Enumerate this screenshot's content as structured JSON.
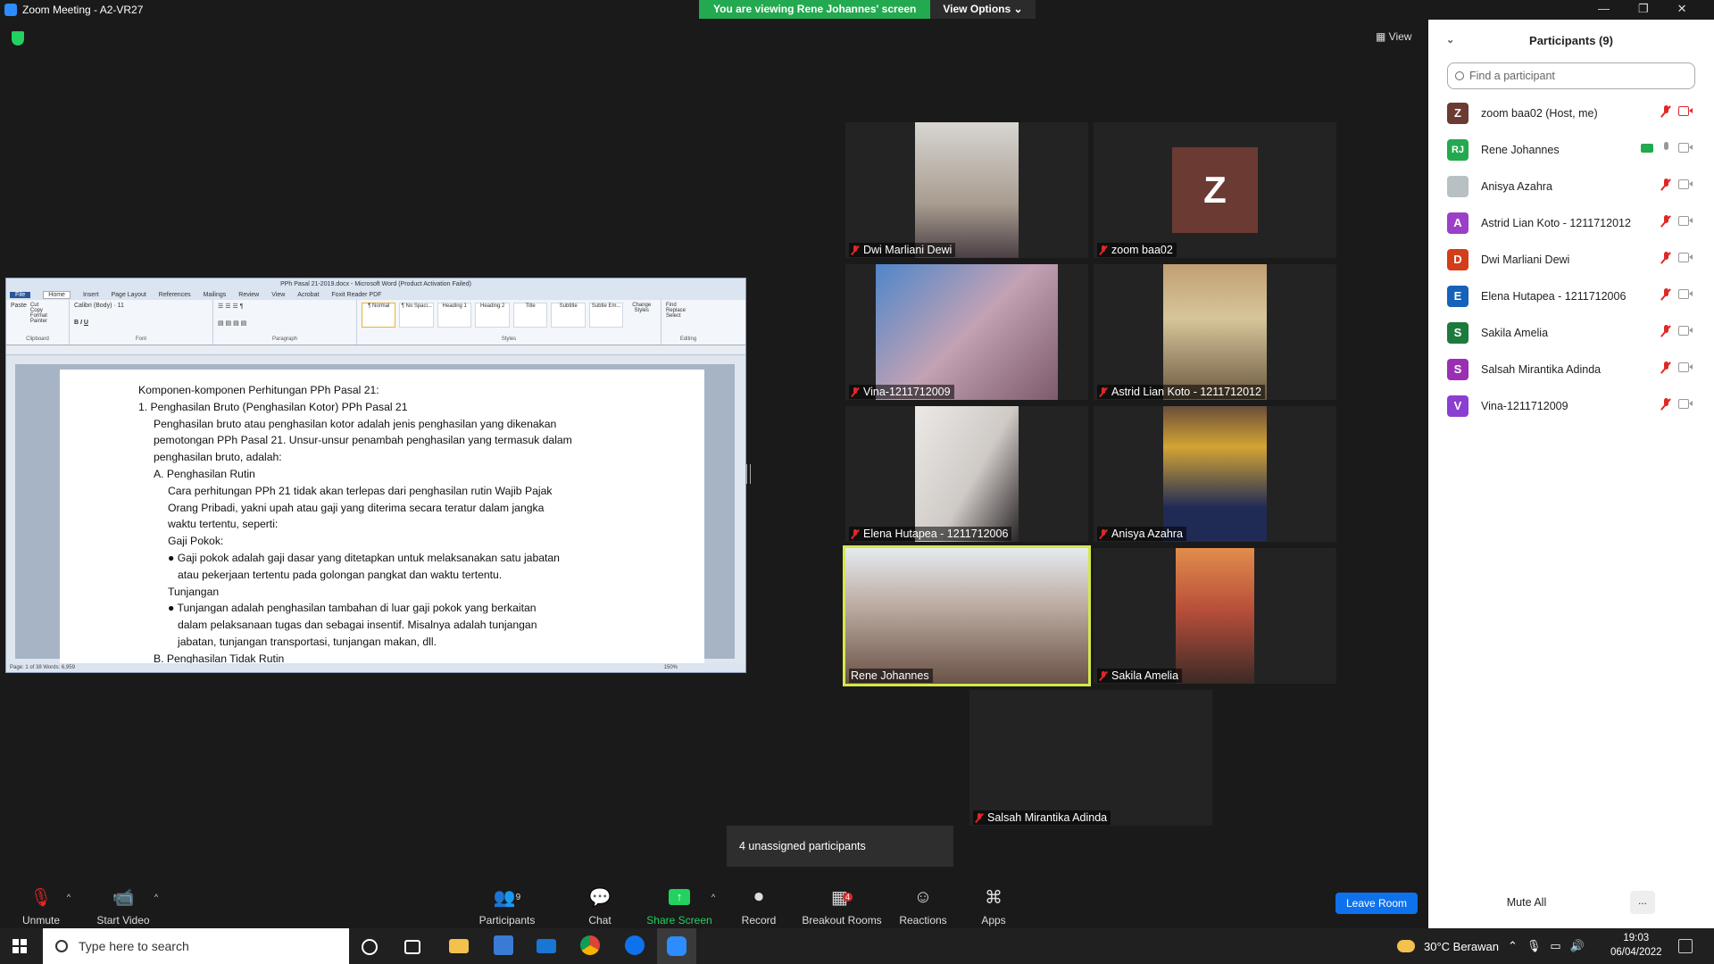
{
  "window": {
    "title": "Zoom Meeting - A2-VR27",
    "controls": [
      "—",
      "❐",
      "✕"
    ]
  },
  "banner": {
    "message": "You are viewing Rene Johannes' screen",
    "options": "View Options ⌄"
  },
  "view_label": "View",
  "word": {
    "title": "PPh Pasal 21-2019.docx - Microsoft Word (Product Activation Failed)",
    "tabs": [
      "File",
      "Home",
      "Insert",
      "Page Layout",
      "References",
      "Mailings",
      "Review",
      "View",
      "Acrobat",
      "Foxit Reader PDF"
    ],
    "groups": {
      "clipboard": "Clipboard",
      "font": "Font",
      "paragraph": "Paragraph",
      "styles": "Styles",
      "editing": "Editing"
    },
    "clipboard_items": [
      "Paste",
      "Cut",
      "Copy",
      "Format Painter"
    ],
    "font_name": "Calibri (Body)",
    "font_size": "11",
    "style_items": [
      "¶ Normal",
      "¶ No Spaci...",
      "Heading 1",
      "Heading 2",
      "Title",
      "Subtitle",
      "Subtle Em..."
    ],
    "change_styles": "Change Styles",
    "editing_items": [
      "Find",
      "Replace",
      "Select"
    ],
    "lines": [
      "Komponen-komponen Perhitungan PPh Pasal 21:",
      "1.  Penghasilan Bruto (Penghasilan Kotor) PPh Pasal 21",
      "Penghasilan bruto atau penghasilan kotor adalah jenis penghasilan yang dikenakan",
      "pemotongan PPh Pasal 21. Unsur-unsur penambah penghasilan yang termasuk dalam",
      "penghasilan bruto, adalah:",
      "A.  Penghasilan Rutin",
      "Cara perhitungan PPh 21 tidak akan terlepas dari penghasilan rutin Wajib Pajak",
      "Orang Pribadi, yakni upah atau gaji yang diterima secara teratur dalam jangka",
      "waktu tertentu, seperti:",
      "Gaji Pokok:",
      "● Gaji pokok adalah gaji dasar yang ditetapkan untuk melaksanakan satu jabatan",
      "atau pekerjaan tertentu pada golongan pangkat dan waktu tertentu.",
      "Tunjangan",
      "● Tunjangan adalah penghasilan tambahan di luar gaji pokok yang berkaitan",
      "dalam pelaksanaan tugas dan sebagai insentif. Misalnya adalah tunjangan",
      "jabatan, tunjangan transportasi, tunjangan makan, dll.",
      "B.  Penghasilan Tidak Rutin"
    ],
    "status": "Page: 1 of 38   Words: 6,959",
    "zoom": "150%"
  },
  "tiles": [
    {
      "name": "Dwi Marliani Dewi",
      "muted": true
    },
    {
      "name": "zoom baa02",
      "muted": true,
      "initial": "Z"
    },
    {
      "name": "Vina-1211712009",
      "muted": true
    },
    {
      "name": "Astrid Lian Koto - 1211712012",
      "muted": true
    },
    {
      "name": "Elena Hutapea - 1211712006",
      "muted": true
    },
    {
      "name": "Anisya Azahra",
      "muted": true
    },
    {
      "name": "Rene Johannes",
      "muted": false
    },
    {
      "name": "Sakila Amelia",
      "muted": true
    },
    {
      "name": "Salsah Mirantika Adinda",
      "muted": true
    }
  ],
  "unassigned": "4 unassigned participants",
  "toolbar": {
    "unmute": "Unmute",
    "start_video": "Start Video",
    "participants": "Participants",
    "participants_count": "9",
    "chat": "Chat",
    "share_screen": "Share Screen",
    "record": "Record",
    "breakout_rooms": "Breakout Rooms",
    "breakout_count": "4",
    "reactions": "Reactions",
    "apps": "Apps",
    "leave": "Leave Room"
  },
  "panel": {
    "title": "Participants (9)",
    "search_placeholder": "Find a participant",
    "participants": [
      {
        "initial": "Z",
        "name": "zoom baa02 (Host, me)",
        "color": "#6b3a32"
      },
      {
        "initial": "RJ",
        "name": "Rene Johannes",
        "color": "#23a94f"
      },
      {
        "initial": "",
        "name": "Anisya Azahra",
        "color": "#b9c0c4"
      },
      {
        "initial": "A",
        "name": "Astrid Lian Koto - 1211712012",
        "color": "#9b3fc7"
      },
      {
        "initial": "D",
        "name": "Dwi Marliani Dewi",
        "color": "#d43d1a"
      },
      {
        "initial": "E",
        "name": "Elena Hutapea - 1211712006",
        "color": "#1562b8"
      },
      {
        "initial": "S",
        "name": "Sakila Amelia",
        "color": "#1e7a3c"
      },
      {
        "initial": "S",
        "name": "Salsah Mirantika Adinda",
        "color": "#9b2fb3"
      },
      {
        "initial": "V",
        "name": "Vina-1211712009",
        "color": "#8a3fd1"
      }
    ],
    "mute_all": "Mute All",
    "more": "..."
  },
  "taskbar": {
    "search_placeholder": "Type here to search",
    "weather": "30°C  Berawan",
    "time": "19:03",
    "date": "06/04/2022"
  }
}
